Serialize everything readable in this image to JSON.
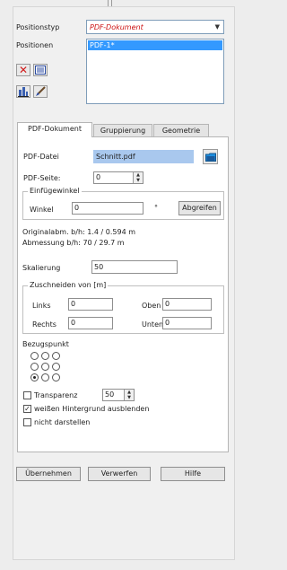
{
  "positionstyp": {
    "label": "Positionstyp",
    "value": "PDF-Dokument"
  },
  "positionen": {
    "label": "Positionen",
    "items": [
      "PDF-1*"
    ]
  },
  "tabs": [
    "PDF-Dokument",
    "Gruppierung",
    "Geometrie"
  ],
  "pdf_datei": {
    "label": "PDF-Datei",
    "value": "Schnitt.pdf"
  },
  "pdf_seite": {
    "label": "PDF-Seite:",
    "value": "0"
  },
  "einfuegewinkel": {
    "legend": "Einfügewinkel",
    "winkel_label": "Winkel",
    "winkel_value": "0",
    "unit": "°",
    "button": "Abgreifen"
  },
  "info": {
    "original": "Originalabm. b/h: 1.4 / 0.594 m",
    "abmessung": "Abmessung b/h: 70 / 29.7 m"
  },
  "skalierung": {
    "label": "Skalierung",
    "value": "50"
  },
  "zuschneiden": {
    "legend": "Zuschneiden von [m]",
    "links_label": "Links",
    "links_value": "0",
    "oben_label": "Oben",
    "oben_value": "0",
    "rechts_label": "Rechts",
    "rechts_value": "0",
    "unten_label": "Unten",
    "unten_value": "0"
  },
  "bezugspunkt": {
    "label": "Bezugspunkt",
    "selected": "bottom-left"
  },
  "transparenz": {
    "label": "Transparenz",
    "value": "50",
    "checked": false
  },
  "weissen": {
    "label": "weißen Hintergrund ausblenden",
    "checked": true
  },
  "nicht_darstellen": {
    "label": "nicht darstellen",
    "checked": false
  },
  "buttons": {
    "uebernehmen": "Übernehmen",
    "verwerfen": "Verwerfen",
    "hilfe": "Hilfe"
  },
  "colors": {
    "accent": "#3399ff",
    "field_highlight": "#a9c8ee",
    "delete_red": "#d11a1a"
  },
  "icons": [
    "delete-icon",
    "list-icon",
    "building-icon",
    "brush-icon",
    "folder-icon"
  ]
}
